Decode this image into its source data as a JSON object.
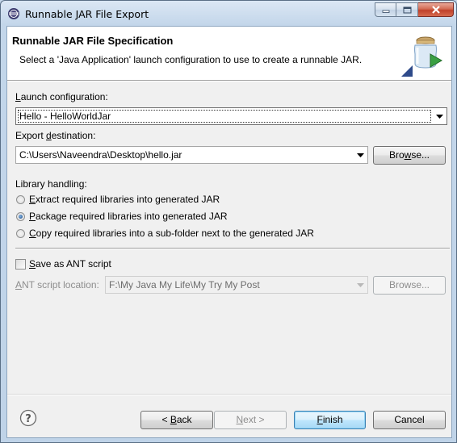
{
  "window": {
    "title": "Runnable JAR File Export",
    "minimize_icon": "minimize-icon",
    "maximize_icon": "maximize-icon",
    "close_icon": "close-icon"
  },
  "header": {
    "title": "Runnable JAR File Specification",
    "description": "Select a 'Java Application' launch configuration to use to create a runnable JAR.",
    "image_icon": "jar-export-wizard-icon"
  },
  "launch": {
    "label_mnemonic": "L",
    "label_rest": "aunch configuration:",
    "value": "Hello - HelloWorldJar"
  },
  "destination": {
    "label_pre": "Export ",
    "label_mnemonic": "d",
    "label_rest": "estination:",
    "value": "C:\\Users\\Naveendra\\Desktop\\hello.jar",
    "browse_mnemonic": "w",
    "browse_pre": "Bro",
    "browse_rest": "se..."
  },
  "library": {
    "label": "Library handling:",
    "options": [
      {
        "mnemonic": "E",
        "rest": "xtract required libraries into generated JAR",
        "checked": false
      },
      {
        "mnemonic": "P",
        "rest": "ackage required libraries into generated JAR",
        "checked": true
      },
      {
        "mnemonic": "C",
        "rest": "opy required libraries into a sub-folder next to the generated JAR",
        "checked": false
      }
    ]
  },
  "ant": {
    "save_mnemonic": "S",
    "save_rest": "ave as ANT script",
    "save_checked": false,
    "location_mnemonic": "A",
    "location_rest": "NT script location:",
    "location_value": "F:\\My Java My Life\\My Try My Post",
    "browse_label": "Browse..."
  },
  "footer": {
    "help_icon": "help-icon",
    "back_pre": "< ",
    "back_mnemonic": "B",
    "back_rest": "ack",
    "next_mnemonic": "N",
    "next_rest": "ext >",
    "finish_mnemonic": "F",
    "finish_rest": "inish",
    "cancel_label": "Cancel"
  }
}
